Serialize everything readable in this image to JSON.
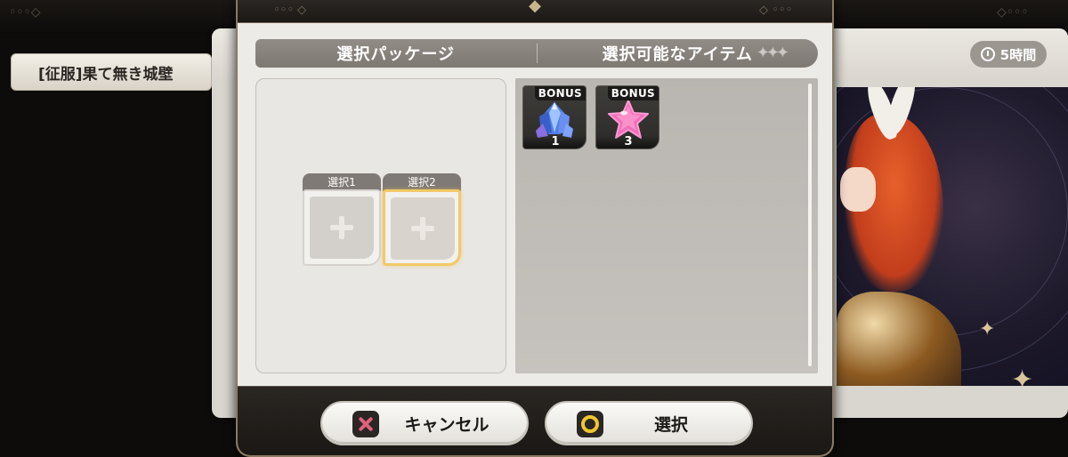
{
  "background": {
    "conquest_tab_label": "[征服]果て無き城壁",
    "timer_label": "5時間"
  },
  "modal": {
    "header": {
      "left_title": "選択パッケージ",
      "right_title": "選択可能なアイテム"
    },
    "slots": [
      {
        "label": "選択1",
        "selected": false
      },
      {
        "label": "選択2",
        "selected": true
      }
    ],
    "items": [
      {
        "icon": "crystal-icon",
        "badge": "BONUS",
        "quantity": "1"
      },
      {
        "icon": "pink-star-icon",
        "badge": "BONUS",
        "quantity": "3"
      }
    ],
    "buttons": {
      "cancel_label": "キャンセル",
      "select_label": "選択"
    }
  },
  "colors": {
    "accent_gold": "#f2c969",
    "cancel_icon": "#e0607c",
    "select_icon": "#f0c531",
    "header_bar": "#8a847e"
  }
}
